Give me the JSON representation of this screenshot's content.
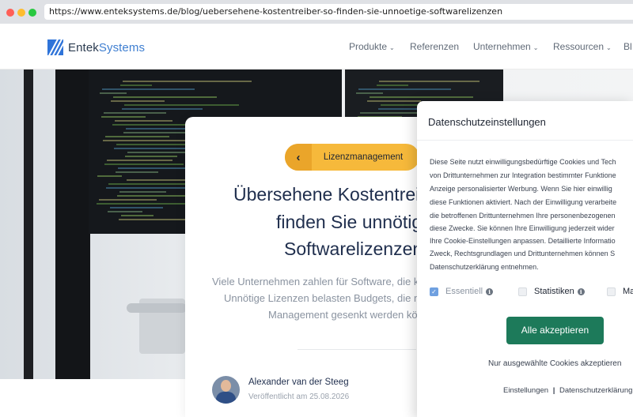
{
  "browser": {
    "url": "https://www.enteksystems.de/blog/uebersehene-kostentreiber-so-finden-sie-unnoetige-softwarelizenzen"
  },
  "header": {
    "logo_part1": "Entek",
    "logo_part2": "Systems",
    "nav": [
      {
        "label": "Produkte",
        "has_dropdown": true
      },
      {
        "label": "Referenzen",
        "has_dropdown": false
      },
      {
        "label": "Unternehmen",
        "has_dropdown": true
      },
      {
        "label": "Ressourcen",
        "has_dropdown": true
      },
      {
        "label": "Bl",
        "has_dropdown": false
      }
    ]
  },
  "article": {
    "category": "Lizenzmanagement",
    "title_lines": [
      "Übersehene Kostentrei",
      "finden Sie unnötig",
      "Softwarelizenzen"
    ],
    "lead_lines": [
      "Viele Unternehmen zahlen für Software, die ka",
      "Unnötige Lizenzen belasten Budgets, die mi",
      "Management gesenkt werden kön"
    ],
    "author": "Alexander van der Steeg",
    "published": "Veröffentlicht am 25.08.2026"
  },
  "consent": {
    "title": "Datenschutzeinstellungen",
    "text_lines": [
      "Diese Seite nutzt einwilligungsbedürftige Cookies und Tech",
      "von Drittunternehmen zur Integration bestimmter Funktione",
      "Anzeige personalisierter Werbung. Wenn Sie hier einwillig",
      "diese Funktionen aktiviert. Nach der Einwilligung verarbeite",
      "die betroffenen Drittunternehmen Ihre personenbezogenen",
      "diese Zwecke. Sie können Ihre Einwilligung jederzeit wider",
      "Ihre Cookie-Einstellungen anpassen. Detaillierte Informatio",
      "Zweck, Rechtsgrundlagen und Drittunternehmen können S",
      "Datenschutzerklärung entnehmen."
    ],
    "options": [
      {
        "label": "Essentiell",
        "checked": true,
        "disabled": true
      },
      {
        "label": "Statistiken",
        "checked": false,
        "disabled": false
      },
      {
        "label": "Ma",
        "checked": false,
        "disabled": false
      }
    ],
    "accept_all": "Alle akzeptieren",
    "accept_selected": "Nur ausgewählte Cookies akzeptieren",
    "settings_link": "Einstellungen",
    "link_separator": "|",
    "privacy_link": "Datenschutzerklärung"
  },
  "colors": {
    "brand_blue": "#2f74d9",
    "navy": "#1f2e4d",
    "category_yellow": "#f6b93b",
    "accept_green": "#1d7a5a"
  }
}
